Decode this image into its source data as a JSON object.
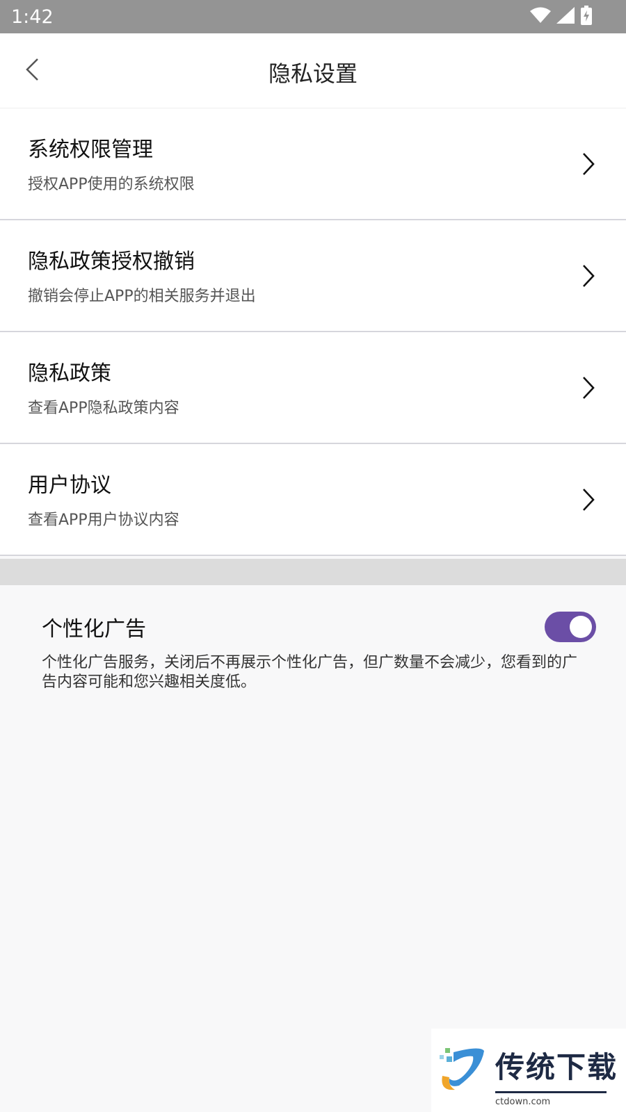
{
  "status_bar": {
    "time": "1:42",
    "icons": [
      "wifi-icon",
      "signal-icon",
      "battery-charging-icon"
    ]
  },
  "header": {
    "title": "隐私设置",
    "back_icon": "chevron-left-icon"
  },
  "menu": {
    "items": [
      {
        "title": "系统权限管理",
        "subtitle": "授权APP使用的系统权限"
      },
      {
        "title": "隐私政策授权撤销",
        "subtitle": "撤销会停止APP的相关服务并退出"
      },
      {
        "title": "隐私政策",
        "subtitle": "查看APP隐私政策内容"
      },
      {
        "title": "用户协议",
        "subtitle": "查看APP用户协议内容"
      }
    ]
  },
  "ads": {
    "title": "个性化广告",
    "enabled": true,
    "description": "个性化广告服务，关闭后不再展示个性化广告，但广数量不会减少，您看到的广告内容可能和您兴趣相关度低。"
  },
  "watermark": {
    "text": "传统下载",
    "url": "ctdown.com"
  },
  "colors": {
    "accent": "#6b4ea6",
    "status_bar": "#949494",
    "divider": "#d6d6dc"
  }
}
